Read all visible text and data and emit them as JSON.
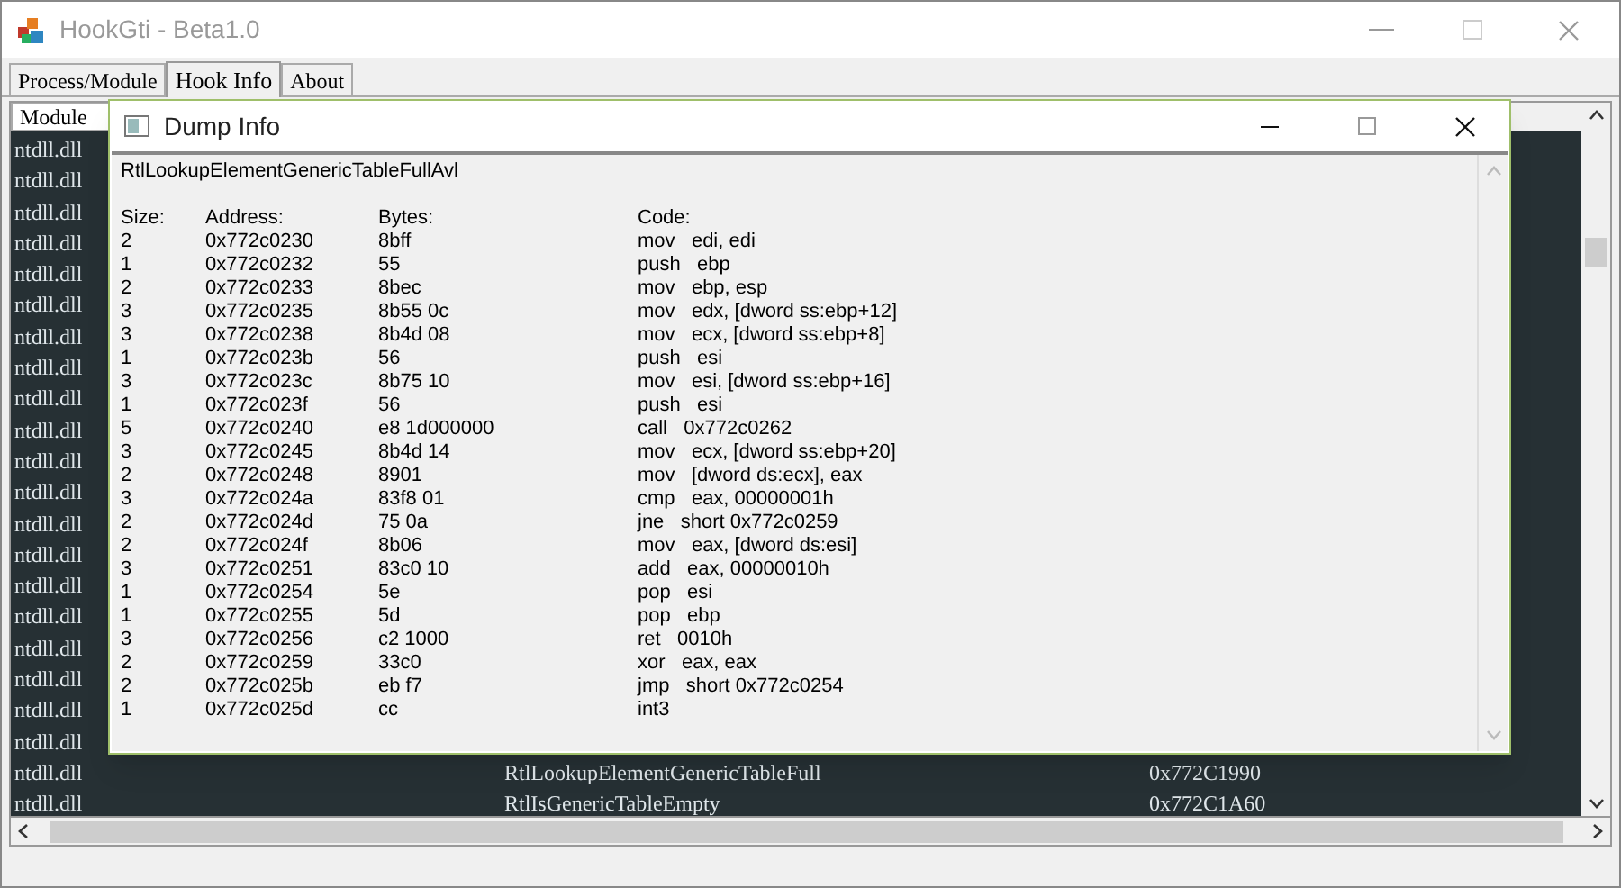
{
  "window": {
    "title": "HookGti - Beta1.0"
  },
  "tabs": [
    {
      "label": "Process/Module",
      "selected": false
    },
    {
      "label": "Hook Info",
      "selected": true
    },
    {
      "label": "About",
      "selected": false
    }
  ],
  "list": {
    "columns": [
      "Module"
    ],
    "rows": [
      {
        "module": "ntdll.dll"
      },
      {
        "module": "ntdll.dll"
      },
      {
        "module": "ntdll.dll"
      },
      {
        "module": "ntdll.dll"
      },
      {
        "module": "ntdll.dll"
      },
      {
        "module": "ntdll.dll"
      },
      {
        "module": "ntdll.dll"
      },
      {
        "module": "ntdll.dll"
      },
      {
        "module": "ntdll.dll"
      },
      {
        "module": "ntdll.dll"
      },
      {
        "module": "ntdll.dll"
      },
      {
        "module": "ntdll.dll"
      },
      {
        "module": "ntdll.dll"
      },
      {
        "module": "ntdll.dll"
      },
      {
        "module": "ntdll.dll"
      },
      {
        "module": "ntdll.dll"
      },
      {
        "module": "ntdll.dll"
      },
      {
        "module": "ntdll.dll"
      },
      {
        "module": "ntdll.dll"
      },
      {
        "module": "ntdll.dll"
      },
      {
        "module": "ntdll.dll",
        "function": "RtlLookupElementGenericTableFull",
        "address": "0x772C1990"
      },
      {
        "module": "ntdll.dll",
        "function": "RtlIsGenericTableEmpty",
        "address": "0x772C1A60"
      }
    ]
  },
  "dialog": {
    "title": "Dump Info",
    "function": "RtlLookupElementGenericTableFullAvl",
    "headers": [
      "Size:",
      "Address:",
      "Bytes:",
      "Code:"
    ],
    "rows": [
      [
        "2",
        "0x772c0230",
        "8bff",
        "mov",
        "edi, edi"
      ],
      [
        "1",
        "0x772c0232",
        "55",
        "push",
        "ebp"
      ],
      [
        "2",
        "0x772c0233",
        "8bec",
        "mov",
        "ebp, esp"
      ],
      [
        "3",
        "0x772c0235",
        "8b55 0c",
        "mov",
        "edx, [dword ss:ebp+12]"
      ],
      [
        "3",
        "0x772c0238",
        "8b4d 08",
        "mov",
        "ecx, [dword ss:ebp+8]"
      ],
      [
        "1",
        "0x772c023b",
        "56",
        "push",
        "esi"
      ],
      [
        "3",
        "0x772c023c",
        "8b75 10",
        "mov",
        "esi, [dword ss:ebp+16]"
      ],
      [
        "1",
        "0x772c023f",
        "56",
        "push",
        "esi"
      ],
      [
        "5",
        "0x772c0240",
        "e8 1d000000",
        "call",
        "0x772c0262"
      ],
      [
        "3",
        "0x772c0245",
        "8b4d 14",
        "mov",
        "ecx, [dword ss:ebp+20]"
      ],
      [
        "2",
        "0x772c0248",
        "8901",
        "mov",
        "[dword ds:ecx], eax"
      ],
      [
        "3",
        "0x772c024a",
        "83f8 01",
        "cmp",
        "eax, 00000001h"
      ],
      [
        "2",
        "0x772c024d",
        "75 0a",
        "jne",
        "short 0x772c0259"
      ],
      [
        "2",
        "0x772c024f",
        "8b06",
        "mov",
        "eax, [dword ds:esi]"
      ],
      [
        "3",
        "0x772c0251",
        "83c0 10",
        "add",
        "eax, 00000010h"
      ],
      [
        "1",
        "0x772c0254",
        "5e",
        "pop",
        "esi"
      ],
      [
        "1",
        "0x772c0255",
        "5d",
        "pop",
        "ebp"
      ],
      [
        "3",
        "0x772c0256",
        "c2 1000",
        "ret",
        "0010h"
      ],
      [
        "2",
        "0x772c0259",
        "33c0",
        "xor",
        "eax, eax"
      ],
      [
        "2",
        "0x772c025b",
        "eb f7",
        "jmp",
        "short 0x772c0254"
      ],
      [
        "1",
        "0x772c025d",
        "cc",
        "int3",
        ""
      ]
    ]
  }
}
